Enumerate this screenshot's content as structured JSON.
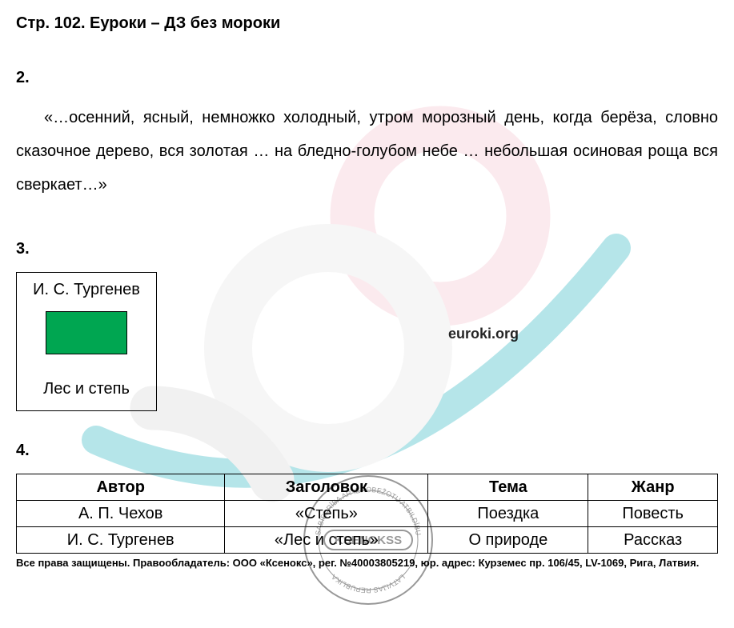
{
  "title": "Стр. 102. Еуроки – ДЗ без мороки",
  "sections": {
    "s2": {
      "num": "2.",
      "quote": "«…осенний, ясный, немножко холодный, утром морозный день, когда берёза, словно сказочное дерево, вся золотая … на бледно-голубом небе … небольшая осиновая роща вся сверкает…»"
    },
    "s3": {
      "num": "3.",
      "author": "И. С. Тургенев",
      "work": "Лес и степь"
    },
    "s4": {
      "num": "4.",
      "headers": [
        "Автор",
        "Заголовок",
        "Тема",
        "Жанр"
      ],
      "rows": [
        {
          "author": "А. П. Чехов",
          "title": "«Степь»",
          "topic": "Поездка",
          "genre": "Повесть"
        },
        {
          "author": "И. С. Тургенев",
          "title": "«Лес и степь»",
          "topic": "О природе",
          "genre": "Рассказ"
        }
      ]
    }
  },
  "footer": "Все права защищены. Правообладатель: ООО «Ксенокс», рег. №40003805219, юр. адрес: Курземес пр. 106/45, LV-1069, Рига, Латвия.",
  "watermark": {
    "domain": "euroki.org",
    "stamp_center": "KSENOKSS",
    "stamp_ring_top": "SABIEDRĪBA AR IEROBEŽOTU ATBILDĪBU",
    "stamp_ring_bottom": "LATVIJAS REPUBLIKA"
  }
}
